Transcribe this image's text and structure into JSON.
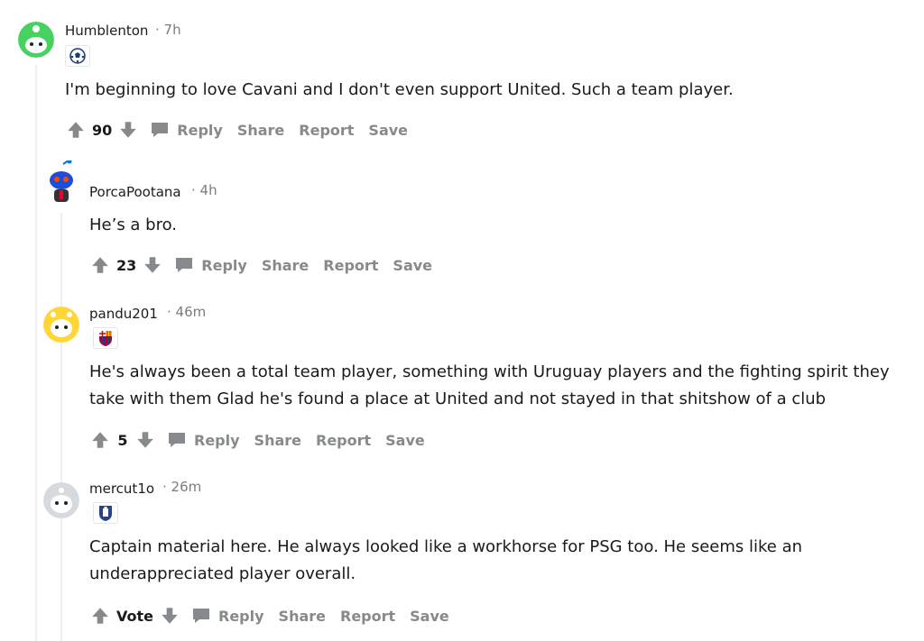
{
  "comments": [
    {
      "username": "Humblenton",
      "time": "· 7h",
      "flair_icon": "soccer-ball-icon",
      "body": "I'm beginning to love Cavani and I don't even support United. Such a team player.",
      "score": "90",
      "actions": {
        "reply": "Reply",
        "share": "Share",
        "report": "Report",
        "save": "Save"
      },
      "avatar_color": "#46d160"
    },
    {
      "username": "PorcaPootana",
      "time": "· 4h",
      "flair_icon": "",
      "body": "He’s a bro.",
      "score": "23",
      "actions": {
        "reply": "Reply",
        "share": "Share",
        "report": "Report",
        "save": "Save"
      },
      "avatar_color": "#0079d3"
    },
    {
      "username": "pandu201",
      "time": "· 46m",
      "flair_icon": "barcelona-crest-icon",
      "body_lines": [
        "He's always been a total team player, something with Uruguay players and the fighting spirit they",
        "take with them Glad he's found a place at United and not stayed in that shitshow of a club"
      ],
      "score": "5",
      "actions": {
        "reply": "Reply",
        "share": "Share",
        "report": "Report",
        "save": "Save"
      },
      "avatar_color": "#ffd635"
    },
    {
      "username": "mercut1o",
      "time": "· 26m",
      "flair_icon": "everton-crest-icon",
      "body_lines": [
        "Captain material here. He always looked like a workhorse for PSG too. He seems like an",
        "underappreciated player overall."
      ],
      "score": "Vote",
      "actions": {
        "reply": "Reply",
        "share": "Share",
        "report": "Report",
        "save": "Save"
      },
      "avatar_color": "#d7dadc"
    }
  ],
  "colors": {
    "meta_gray": "#878a8c",
    "thread_line": "#edeff1",
    "text": "#1a1a1b"
  }
}
